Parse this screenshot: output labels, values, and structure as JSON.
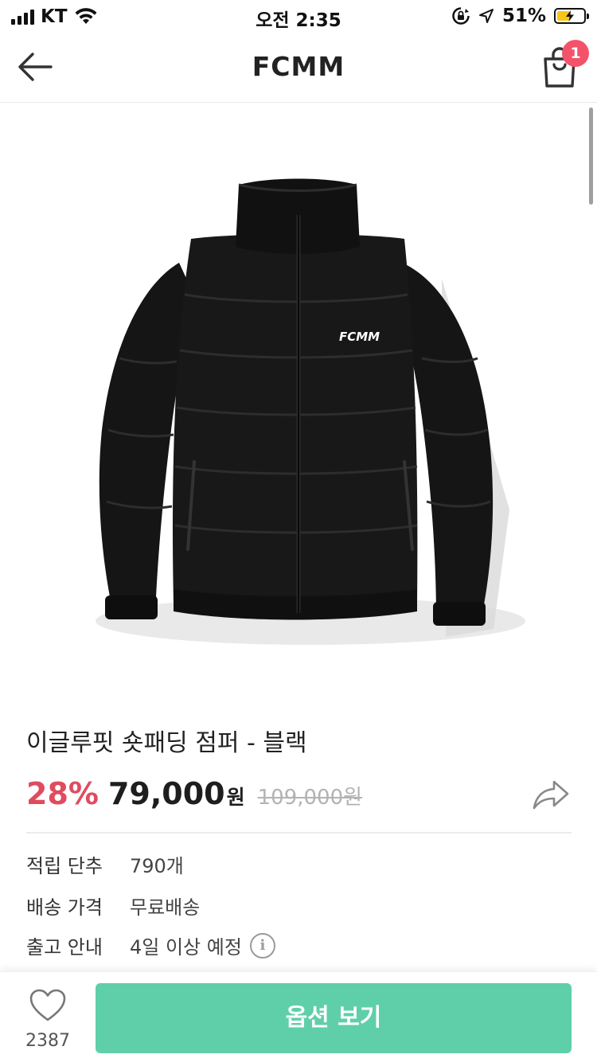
{
  "status_bar": {
    "carrier": "KT",
    "time": "오전 2:35",
    "battery_percent": "51%",
    "battery_level": 0.51,
    "icons": [
      "signal-icon",
      "wifi-icon",
      "rotation-lock-icon",
      "location-icon",
      "battery-icon"
    ]
  },
  "nav": {
    "title": "FCMM",
    "cart_count": "1",
    "back_icon": "arrow-left-icon",
    "cart_icon": "shopping-bag-icon"
  },
  "product": {
    "image_logo_text": "FCMM",
    "title": "이글루핏 숏패딩 점퍼 - 블랙",
    "discount": "28%",
    "price": "79,000",
    "currency": "원",
    "original_price": "109,000원",
    "share_icon": "share-arrow-icon"
  },
  "info": {
    "points_label": "적립 단추",
    "points_value": "790개",
    "shipping_label": "배송 가격",
    "shipping_value": "무료배송",
    "release_label": "출고 안내",
    "release_value": "4일 이상 예정",
    "release_info_icon": "info-icon",
    "info_glyph": "i"
  },
  "bottom": {
    "like_count": "2387",
    "like_icon": "heart-icon",
    "options_label": "옵션 보기"
  },
  "colors": {
    "accent": "#5fcfaa",
    "discount": "#e04b5f",
    "badge": "#f2536a",
    "battery": "#f5c518"
  }
}
